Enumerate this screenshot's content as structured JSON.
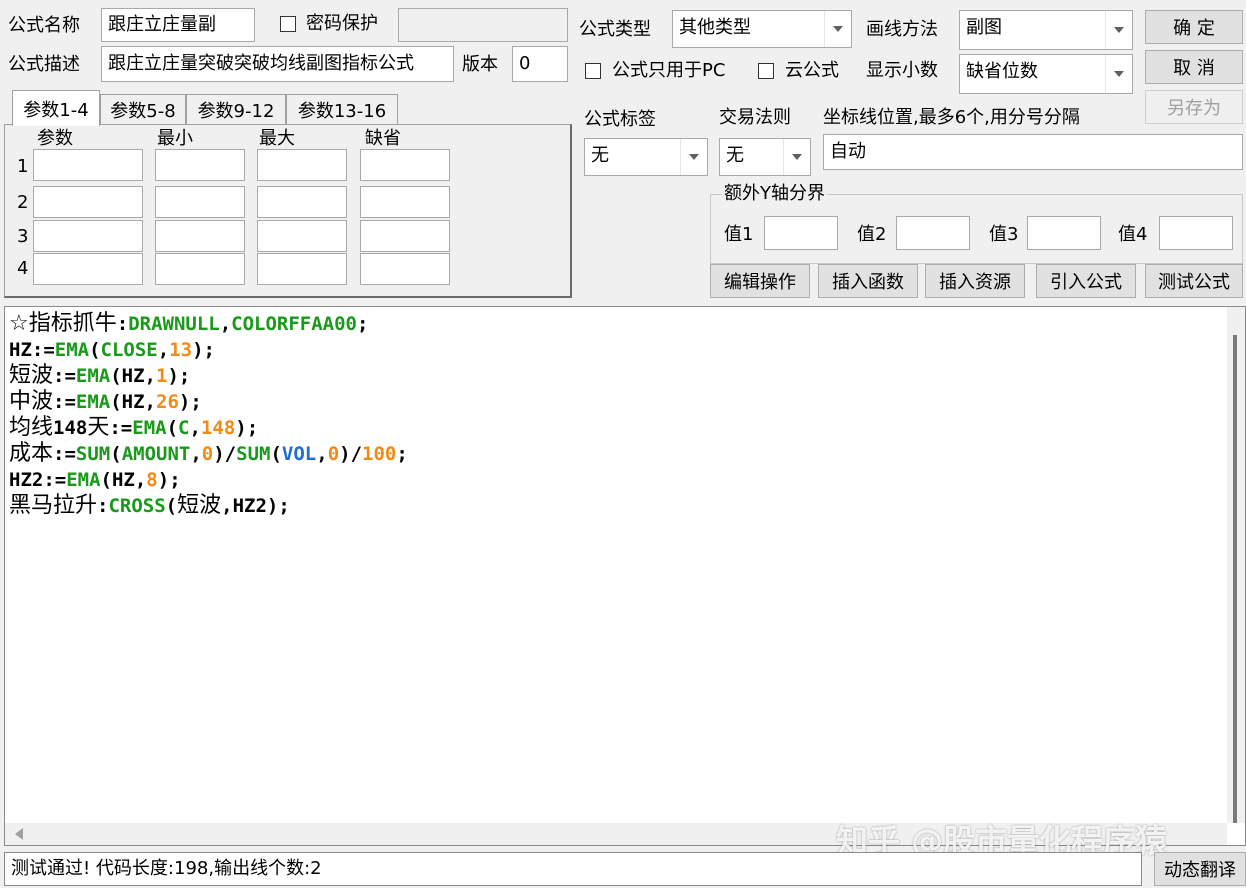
{
  "header": {
    "name_label": "公式名称",
    "name_value": "跟庄立庄量副",
    "password_label": "密码保护",
    "desc_label": "公式描述",
    "desc_value": "跟庄立庄量突破突破均线副图指标公式",
    "version_label": "版本",
    "version_value": "0",
    "type_label": "公式类型",
    "type_value": "其他类型",
    "draw_label": "画线方法",
    "draw_value": "副图",
    "pc_only_label": "公式只用于PC",
    "cloud_label": "云公式",
    "decimals_label": "显示小数",
    "decimals_value": "缺省位数"
  },
  "buttons": {
    "ok": "确  定",
    "cancel": "取  消",
    "save_as": "另存为",
    "edit_ops": "编辑操作",
    "insert_func": "插入函数",
    "insert_res": "插入资源",
    "import_formula": "引入公式",
    "test_formula": "测试公式",
    "dynamic_translate": "动态翻译"
  },
  "tabs": [
    "参数1-4",
    "参数5-8",
    "参数9-12",
    "参数13-16"
  ],
  "params": {
    "headers": [
      "参数",
      "最小",
      "最大",
      "缺省"
    ],
    "rows": [
      "1",
      "2",
      "3",
      "4"
    ]
  },
  "tags": {
    "formula_tag_label": "公式标签",
    "formula_tag_value": "无",
    "trade_rule_label": "交易法则",
    "trade_rule_value": "无",
    "axis_label": "坐标线位置,最多6个,用分号分隔",
    "axis_value": "自动"
  },
  "y_axis": {
    "title": "额外Y轴分界",
    "v1": "值1",
    "v2": "值2",
    "v3": "值3",
    "v4": "值4"
  },
  "code": {
    "l1a": "☆指标抓牛",
    "l1b": ":",
    "l1c": "DRAWNULL",
    "l1d": ",",
    "l1e": "COLORFFAA00",
    "l1f": ";",
    "l2a": "HZ:=",
    "l2b": "EMA",
    "l2c": "(",
    "l2d": "CLOSE",
    "l2e": ",",
    "l2f": "13",
    "l2g": ");",
    "l3a": "短波",
    "l3b": ":=",
    "l3c": "EMA",
    "l3d": "(HZ,",
    "l3e": "1",
    "l3f": ");",
    "l4a": "中波",
    "l4b": ":=",
    "l4c": "EMA",
    "l4d": "(HZ,",
    "l4e": "26",
    "l4f": ");",
    "l5a": "均线",
    "l5b": "148",
    "l5c": "天",
    "l5d": ":=",
    "l5e": "EMA",
    "l5f": "(",
    "l5g": "C",
    "l5h": ",",
    "l5i": "148",
    "l5j": ");",
    "l6a": "成本",
    "l6b": ":=",
    "l6c": "SUM",
    "l6d": "(",
    "l6e": "AMOUNT",
    "l6f": ",",
    "l6g": "0",
    "l6h": ")/",
    "l6i": "SUM",
    "l6j": "(",
    "l6k": "VOL",
    "l6l": ",",
    "l6m": "0",
    "l6n": ")/",
    "l6o": "100",
    "l6p": ";",
    "l7a": "HZ2:=",
    "l7b": "EMA",
    "l7c": "(HZ,",
    "l7d": "8",
    "l7e": ");",
    "l8a": "黑马拉升",
    "l8b": ":",
    "l8c": "CROSS",
    "l8d": "(",
    "l8e": "短波",
    "l8f": ",HZ2);"
  },
  "status": "测试通过! 代码长度:198,输出线个数:2",
  "watermark": "知乎 @股市量化程序猿",
  "colors": {
    "keyword": "#1a9a1a",
    "number": "#f28a17",
    "variable": "#1b6fd6"
  }
}
